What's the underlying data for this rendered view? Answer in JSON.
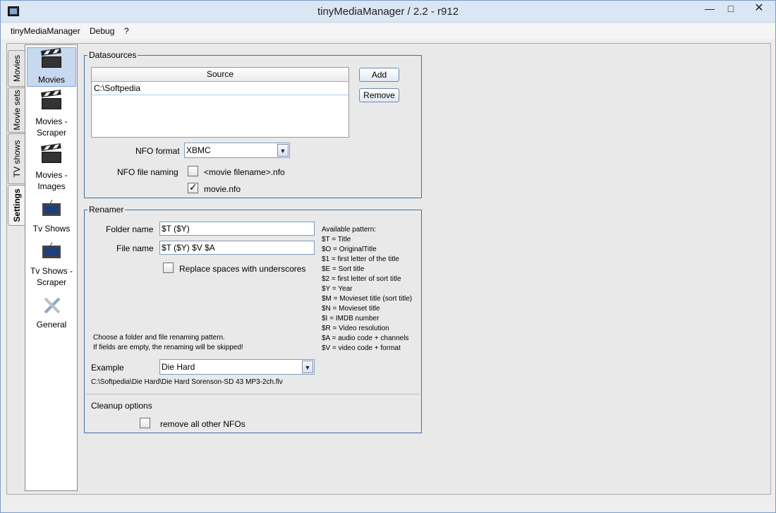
{
  "window": {
    "title": "tinyMediaManager / 2.2 - r912",
    "controls": [
      "—",
      "□",
      "✕"
    ]
  },
  "menubar": {
    "items": [
      "tinyMediaManager",
      "Debug",
      "?"
    ]
  },
  "tabs": [
    "Movies",
    "Movie sets",
    "TV shows",
    "Settings"
  ],
  "sidebar": {
    "items": [
      {
        "label": "Movies",
        "icon": "clapperboard-icon"
      },
      {
        "label": "Movies - Scraper",
        "icon": "clapperboard-icon"
      },
      {
        "label": "Movies - Images",
        "icon": "clapperboard-icon"
      },
      {
        "label": "Tv Shows",
        "icon": "tv-icon"
      },
      {
        "label": "Tv Shows - Scraper",
        "icon": "tv-icon"
      },
      {
        "label": "General",
        "icon": "tools-icon"
      }
    ]
  },
  "datasources": {
    "legend": "Datasources",
    "table_header": "Source",
    "rows": [
      "C:\\Softpedia"
    ],
    "add_label": "Add",
    "remove_label": "Remove",
    "nfo_format_label": "NFO format",
    "nfo_format_value": "XBMC",
    "nfo_naming_label": "NFO file naming",
    "nfo_opt1": "<movie filename>.nfo",
    "nfo_opt2": "movie.nfo"
  },
  "renamer": {
    "legend": "Renamer",
    "folder_label": "Folder name",
    "folder_value": "$T ($Y)",
    "file_label": "File name",
    "file_value": "$T ($Y) $V $A",
    "replace_spaces": "Replace spaces with underscores",
    "patterns": [
      "Available pattern:",
      "$T = Title",
      "$O = OriginalTitle",
      "$1 = first letter of the title",
      "$E = Sort title",
      "$2 = first letter of sort title",
      "$Y = Year",
      "$M = Movieset title (sort title)",
      "$N = Movieset title",
      "$I = IMDB number",
      "$R = Video resolution",
      "$A = audio code + channels",
      "$V = video code + format"
    ],
    "hint1": "Choose a folder and file renaming pattern.",
    "hint2": "If fields are empty, the renaming will be skipped!",
    "example_label": "Example",
    "example_value": "Die Hard",
    "example_path": "C:\\Softpedia\\Die Hard\\Die Hard  Sorenson-SD 43 MP3-2ch.flv",
    "cleanup_label": "Cleanup options",
    "cleanup_option": "remove all other NFOs"
  }
}
